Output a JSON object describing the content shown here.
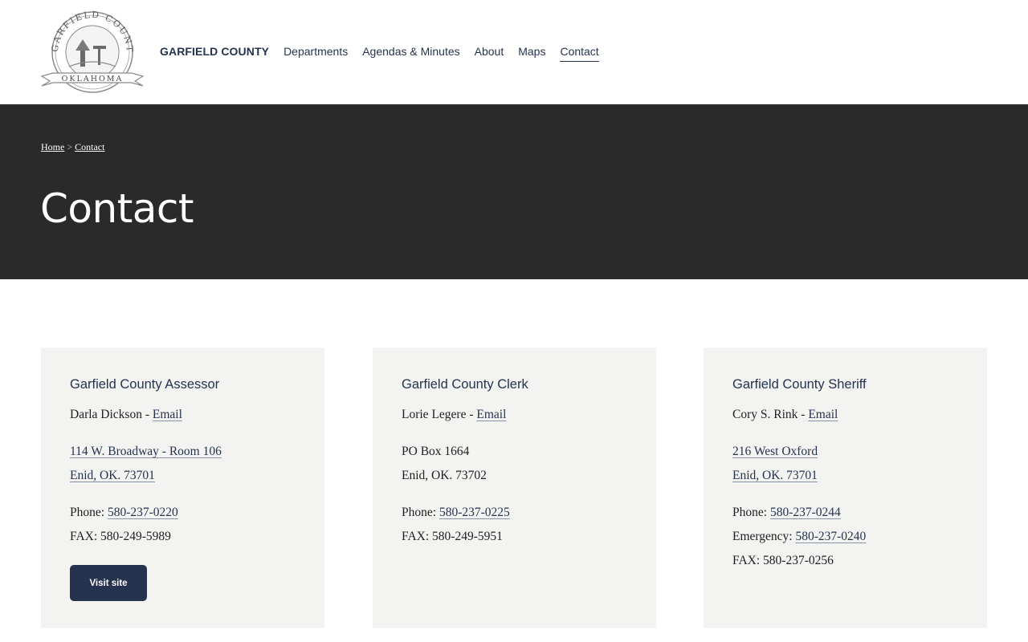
{
  "header": {
    "logo_text_top": "GARFIELD COUNTY",
    "logo_text_banner": "OKLAHOMA",
    "brand": "GARFIELD COUNTY",
    "nav": [
      {
        "label": "Departments"
      },
      {
        "label": "Agendas & Minutes"
      },
      {
        "label": "About"
      },
      {
        "label": "Maps"
      },
      {
        "label": "Contact",
        "active": true
      }
    ]
  },
  "hero": {
    "breadcrumb": {
      "home": "Home",
      "separator": ">",
      "current": "Contact"
    },
    "title": "Contact"
  },
  "cards": [
    {
      "title": "Garfield County Assessor",
      "person": "Darla Dickson - ",
      "email_label": "Email",
      "address_line1": "114 W. Broadway - Room 106",
      "address_line2": "Enid, OK. 73701",
      "phone_label": "Phone: ",
      "phone": "580-237-0220",
      "fax": "FAX: 580-249-5989",
      "button_label": "Visit site"
    },
    {
      "title": "Garfield County Clerk",
      "person": "Lorie Legere - ",
      "email_label": "Email",
      "address_line1": "PO Box 1664",
      "address_line2": "Enid, OK. 73702",
      "phone_label": "Phone: ",
      "phone": "580-237-0225",
      "fax": "FAX: 580-249-5951"
    },
    {
      "title": "Garfield County Sheriff",
      "person": "Cory S. Rink - ",
      "email_label": "Email",
      "address_line1": "216 West Oxford",
      "address_line2": "Enid, OK. 73701",
      "phone_label": "Phone: ",
      "phone": "580-237-0244",
      "emergency_label": "Emergency: ",
      "emergency": "580-237-0240",
      "fax": "FAX: 580-237-0256"
    }
  ],
  "colors": {
    "navy": "#26334f",
    "hero_bg": "#2b2a2a",
    "card_bg": "#f3f3f1"
  }
}
